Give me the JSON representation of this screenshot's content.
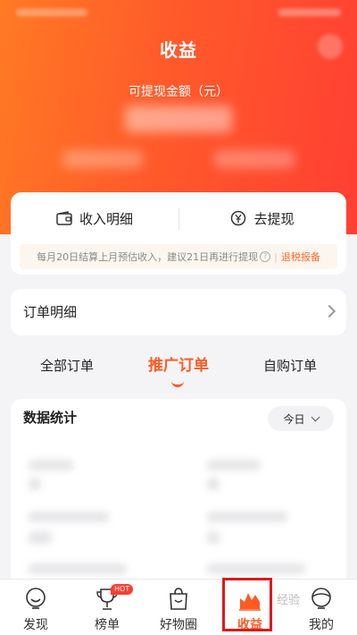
{
  "header": {
    "title": "收益",
    "amount_label": "可提现金额（元）"
  },
  "actions": {
    "income_label": "收入明细",
    "withdraw_label": "去提现",
    "notice_text": "每月20日结算上月预估收入，建议21日再进行提现",
    "notice_link": "退税报备"
  },
  "orders": {
    "label": "订单明细"
  },
  "order_tabs": [
    {
      "label": "全部订单"
    },
    {
      "label": "推广订单",
      "active": true
    },
    {
      "label": "自购订单"
    }
  ],
  "stats": {
    "title": "数据统计",
    "range_selected": "今日"
  },
  "tabbar": {
    "items": [
      {
        "label": "发现",
        "icon": "discover-icon"
      },
      {
        "label": "榜单",
        "icon": "trophy-icon",
        "badge": "HOT"
      },
      {
        "label": "好物圈",
        "icon": "shopping-bag-icon"
      },
      {
        "label": "收益",
        "icon": "earnings-chart-icon",
        "active": true
      },
      {
        "label": "我的",
        "icon": "profile-icon"
      }
    ]
  },
  "colors": {
    "accent": "#ff5a22",
    "hero_start": "#ff7a24",
    "hero_end": "#ff3f33",
    "highlight": "#e01818"
  }
}
